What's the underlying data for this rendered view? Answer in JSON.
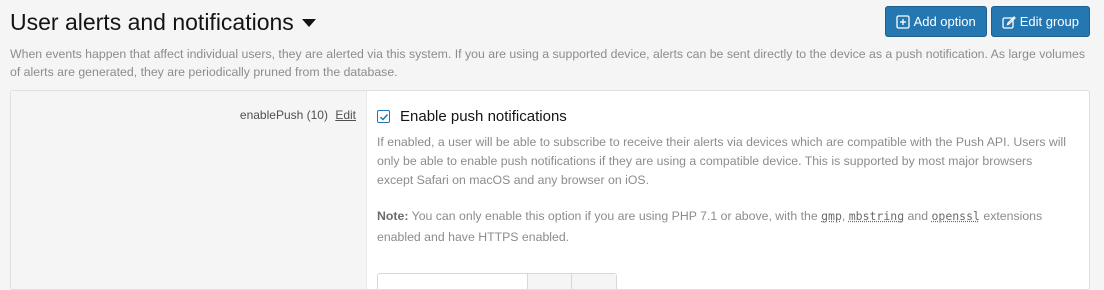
{
  "header": {
    "title": "User alerts and notifications",
    "add_option_label": "Add option",
    "edit_group_label": "Edit group",
    "description": "When events happen that affect individual users, they are alerted via this system. If you are using a supported device, alerts can be sent directly to the device as a push notification. As large volumes of alerts are generated, they are periodically pruned from the database."
  },
  "option": {
    "id_label": "enablePush (10)",
    "edit_link": "Edit",
    "checkbox_label": "Enable push notifications",
    "checked": true,
    "explain": "If enabled, a user will be able to subscribe to receive their alerts via devices which are compatible with the Push API. Users will only be able to enable push notifications if they are using a compatible device. This is supported by most major browsers except Safari on macOS and any browser on iOS.",
    "note_prefix": "Note:",
    "note_text_1": " You can only enable this option if you are using PHP 7.1 or above, with the ",
    "code_1": "gmp",
    "sep_1": ", ",
    "code_2": "mbstring",
    "sep_2": " and ",
    "code_3": "openssl",
    "note_text_2": " extensions enabled and have HTTPS enabled."
  },
  "colors": {
    "primary_button": "#2577b1",
    "muted_text": "#8c8c8c"
  }
}
